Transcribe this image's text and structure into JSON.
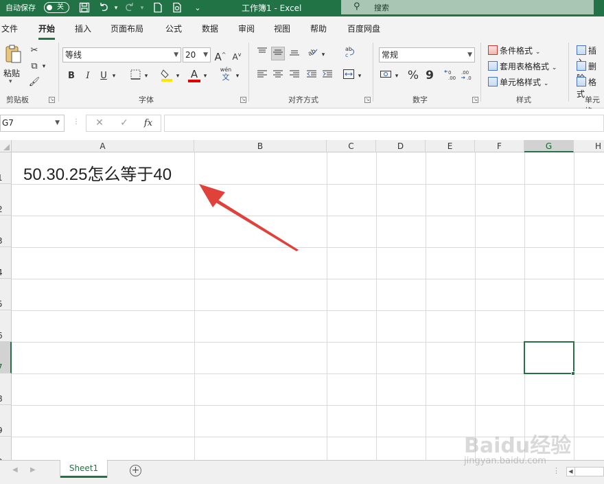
{
  "titlebar": {
    "autosave_label": "自动保存",
    "autosave_state": "关",
    "doc_title": "工作簿1  -  Excel",
    "search_placeholder": "搜索"
  },
  "tabs": [
    "文件",
    "开始",
    "插入",
    "页面布局",
    "公式",
    "数据",
    "审阅",
    "视图",
    "帮助",
    "百度网盘"
  ],
  "active_tab": "开始",
  "ribbon": {
    "clipboard": {
      "paste_label": "粘贴",
      "group_label": "剪贴板"
    },
    "font": {
      "font_name": "等线",
      "font_size": "20",
      "group_label": "字体",
      "bold": "B",
      "italic": "I",
      "underline": "U",
      "grow": "A",
      "shrink": "A",
      "font_color": "A",
      "phonetic_top": "wén",
      "phonetic_bottom": "文"
    },
    "alignment": {
      "group_label": "对齐方式"
    },
    "number": {
      "format": "常规",
      "group_label": "数字",
      "percent": "%",
      "comma": "9"
    },
    "styles": {
      "conditional": "条件格式",
      "table": "套用表格格式",
      "cell": "单元格样式",
      "group_label": "样式"
    },
    "cells": {
      "insert": "插入",
      "delete": "删除",
      "format": "格式",
      "group_label": "单元格"
    }
  },
  "formula_bar": {
    "name_box": "G7",
    "cancel": "✕",
    "enter": "✓",
    "fx": "fx",
    "content": ""
  },
  "grid": {
    "columns": [
      "A",
      "B",
      "C",
      "D",
      "E",
      "F",
      "G",
      "H"
    ],
    "rows": [
      "1",
      "2",
      "3",
      "4",
      "5",
      "6",
      "7",
      "8",
      "9",
      "0"
    ],
    "selected_column": "G",
    "selected_row": "7",
    "a1_value": "50.30.25怎么等于40"
  },
  "sheets": [
    "Sheet1"
  ],
  "colors": {
    "brand": "#217346",
    "arrow": "#e0413a"
  },
  "watermark": {
    "main": "Baidu经验",
    "sub": "jingyan.baidu.com"
  }
}
